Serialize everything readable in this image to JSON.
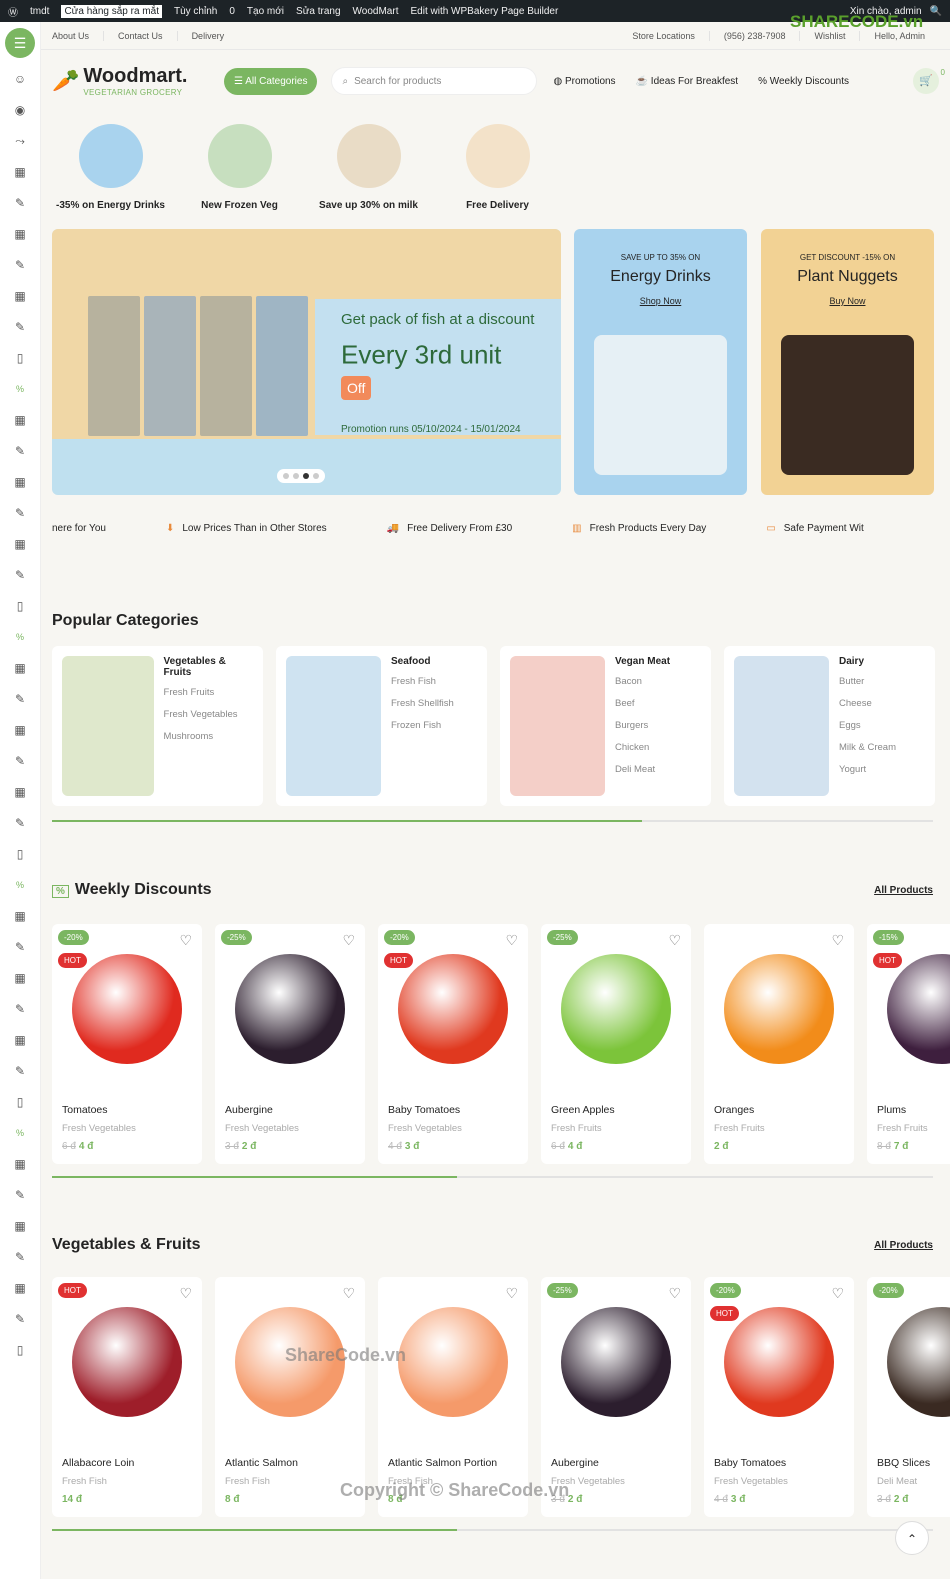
{
  "adminbar": {
    "site": "tmdt",
    "status": "Cửa hàng sắp ra mắt",
    "customize": "Tùy chỉnh",
    "comments": "0",
    "new": "Tạo mới",
    "edit": "Sửa trang",
    "woodmart": "WoodMart",
    "wpbakery": "Edit with WPBakery Page Builder",
    "greeting": "Xin chào, admin"
  },
  "topbar": {
    "links": [
      "About Us",
      "Contact Us",
      "Delivery"
    ],
    "store": "Store Locations",
    "phone": "(956) 238-7908",
    "wishlist": "Wishlist",
    "account": "Hello, Admin"
  },
  "header": {
    "logo": "Woodmart.",
    "tagline": "VEGETARIAN GROCERY",
    "all_categories": "All Categories",
    "search_placeholder": "Search for products",
    "nav": [
      "Promotions",
      "Ideas For Breakfest",
      "Weekly Discounts"
    ],
    "cart_count": "0"
  },
  "stories": [
    "-35% on Energy Drinks",
    "New Frozen Veg",
    "Save up 30% on milk",
    "Free Delivery"
  ],
  "hero": {
    "line1": "Get pack of fish at a discount",
    "line2": "Every 3rd unit",
    "badge": "Off",
    "line3": "Promotion runs 05/10/2024 - 15/01/2024",
    "active_slide": 3,
    "slides": 4
  },
  "promos": [
    {
      "kicker": "SAVE UP TO 35% ON",
      "title": "Energy Drinks",
      "link": "Shop Now",
      "bg": "#a9d3ee"
    },
    {
      "kicker": "GET DISCOUNT -15% ON",
      "title": "Plant Nuggets",
      "link": "Buy Now",
      "bg": "#f2d294"
    }
  ],
  "features": [
    "nere for You",
    "Low Prices Than in Other Stores",
    "Free Delivery From £30",
    "Fresh Products Every Day",
    "Safe Payment Wit"
  ],
  "popular": {
    "title": "Popular Categories",
    "progress": 0.67,
    "items": [
      {
        "title": "Vegetables & Fruits",
        "links": [
          "Fresh Fruits",
          "Fresh Vegetables",
          "Mushrooms"
        ],
        "bg": "#dfe8cc"
      },
      {
        "title": "Seafood",
        "links": [
          "Fresh Fish",
          "Fresh Shellfish",
          "Frozen Fish"
        ],
        "bg": "#cfe3f1"
      },
      {
        "title": "Vegan Meat",
        "links": [
          "Bacon",
          "Beef",
          "Burgers",
          "Chicken",
          "Deli Meat"
        ],
        "bg": "#f4cfc8"
      },
      {
        "title": "Dairy",
        "links": [
          "Butter",
          "Cheese",
          "Eggs",
          "Milk & Cream",
          "Yogurt"
        ],
        "bg": "#d3e2ef"
      }
    ]
  },
  "weekly": {
    "title": "Weekly Discounts",
    "all": "All Products",
    "progress": 0.46,
    "products": [
      {
        "name": "Tomatoes",
        "cat": "Fresh Vegetables",
        "old": "6 đ",
        "price": "4 đ",
        "discount": "-20%",
        "hot": "HOT",
        "color": "#e02a1f"
      },
      {
        "name": "Aubergine",
        "cat": "Fresh Vegetables",
        "old": "3 đ",
        "price": "2 đ",
        "discount": "-25%",
        "color": "#2c1e2e"
      },
      {
        "name": "Baby Tomatoes",
        "cat": "Fresh Vegetables",
        "old": "4 đ",
        "price": "3 đ",
        "discount": "-20%",
        "hot": "HOT",
        "color": "#e0391f"
      },
      {
        "name": "Green Apples",
        "cat": "Fresh Fruits",
        "old": "6 đ",
        "price": "4 đ",
        "discount": "-25%",
        "color": "#7cc43a"
      },
      {
        "name": "Oranges",
        "cat": "Fresh Fruits",
        "price": "2 đ",
        "color": "#f28c1a"
      },
      {
        "name": "Plums",
        "cat": "Fresh Fruits",
        "old": "8 đ",
        "price": "7 đ",
        "discount": "-15%",
        "hot": "HOT",
        "color": "#3e1f3e"
      }
    ]
  },
  "vegfruits": {
    "title": "Vegetables & Fruits",
    "all": "All Products",
    "progress": 0.46,
    "products": [
      {
        "name": "Allabacore Loin",
        "cat": "Fresh Fish",
        "price": "14 đ",
        "hot": "HOT",
        "color": "#9e1e2a"
      },
      {
        "name": "Atlantic Salmon",
        "cat": "Fresh Fish",
        "price": "8 đ",
        "color": "#f59a6a"
      },
      {
        "name": "Atlantic Salmon Portion",
        "cat": "Fresh Fish",
        "price": "8 đ",
        "color": "#f59a6a"
      },
      {
        "name": "Aubergine",
        "cat": "Fresh Vegetables",
        "old": "3 đ",
        "price": "2 đ",
        "discount": "-25%",
        "color": "#2c1e2e"
      },
      {
        "name": "Baby Tomatoes",
        "cat": "Fresh Vegetables",
        "old": "4 đ",
        "price": "3 đ",
        "discount": "-20%",
        "hot": "HOT",
        "color": "#e0391f"
      },
      {
        "name": "BBQ Slices",
        "cat": "Deli Meat",
        "old": "3 đ",
        "price": "2 đ",
        "discount": "-20%",
        "color": "#3a2a22"
      }
    ]
  },
  "watermark": {
    "logo": "SHARECODE.vn",
    "mid": "ShareCode.vn",
    "bottom": "Copyright © ShareCode.vn"
  }
}
